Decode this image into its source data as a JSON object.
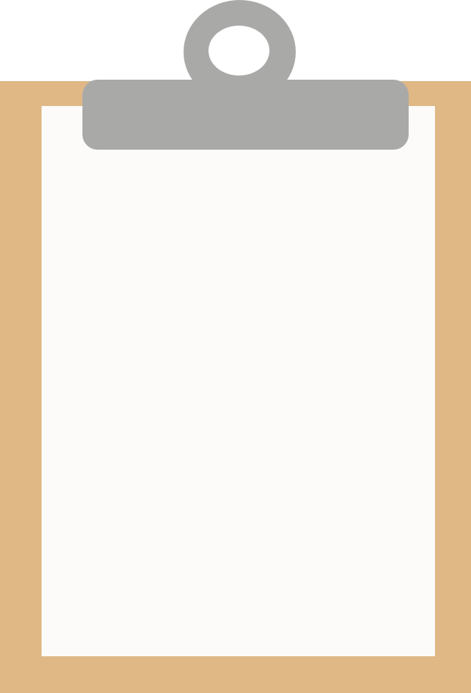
{
  "image": {
    "subject": "clipboard-icon",
    "colors": {
      "board": "#dfb886",
      "paper": "#fcfbf9",
      "clip": "#a9a9a8",
      "background": "#ffffff"
    }
  }
}
